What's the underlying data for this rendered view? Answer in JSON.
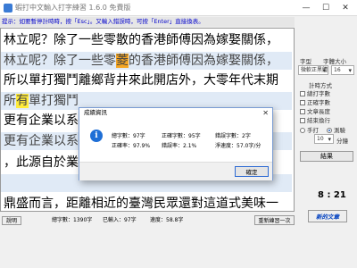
{
  "window": {
    "title": "蝦打中文輸入打字練習 1.6.0 免費版",
    "minimize": "—",
    "maximize": "☐",
    "close": "✕"
  },
  "hint": "提示：如要暫停計時時，按「Esc」。又輸入錯誤時，可按「Enter」直接換表。",
  "lines": {
    "l1": "林立呢？除了一些零散的香港師傅因為嫁娶關係，",
    "l2_pre": "林立呢？除了一些零",
    "l2_hl": "菱",
    "l2_post": "的香港師傅因為嫁娶關係，",
    "l3": "所以單打獨鬥離鄉背井來此開店外，大零年代末期",
    "l4_pre": "所",
    "l4_hl": "有",
    "l4_post": "單打獨鬥",
    "l5": "更有企業以系",
    "l6": "更有企業以系",
    "l7": "，此源自於業",
    "l8": "鼎盛而言，距離相近的臺灣民眾還對這道式美味一"
  },
  "right_panel": {
    "font_label": "字型",
    "font_size_label": "字體大小",
    "font_value": "微軟正黑體",
    "size_value": "16",
    "mode_label": "計時方式",
    "opt_check1": "總打字數",
    "opt_check2": "正確字數",
    "opt_check3": "文章長度",
    "opt_check4": "結束換行",
    "radio1": "手打",
    "radio2": "測驗",
    "minutes_value": "10",
    "minutes_label": "分鐘",
    "result_button": "結果"
  },
  "timer": "8 : 21",
  "new_article": "新的文章",
  "status": {
    "tab": "說明",
    "total": "總字數：1390字",
    "entered": "已輸入：97字",
    "speed": "速度：58.8字",
    "restart": "重新練習一次"
  },
  "dialog": {
    "title": "成績資訊",
    "close": "✕",
    "total_label": "總字數：97字",
    "correct_label": "正確字數：95字",
    "wrong_label": "錯誤字數：2字",
    "accuracy_label": "正確率：97.9%",
    "error_rate_label": "錯誤率：2.1%",
    "speed_label": "淨速度：57.0字/分",
    "ok_button": "確定"
  },
  "colors": {
    "accent": "#1f6fd6",
    "highlight_orange": "#f5a623",
    "highlight_yellow": "#ffeb3b",
    "hint_text": "#0000cc"
  }
}
